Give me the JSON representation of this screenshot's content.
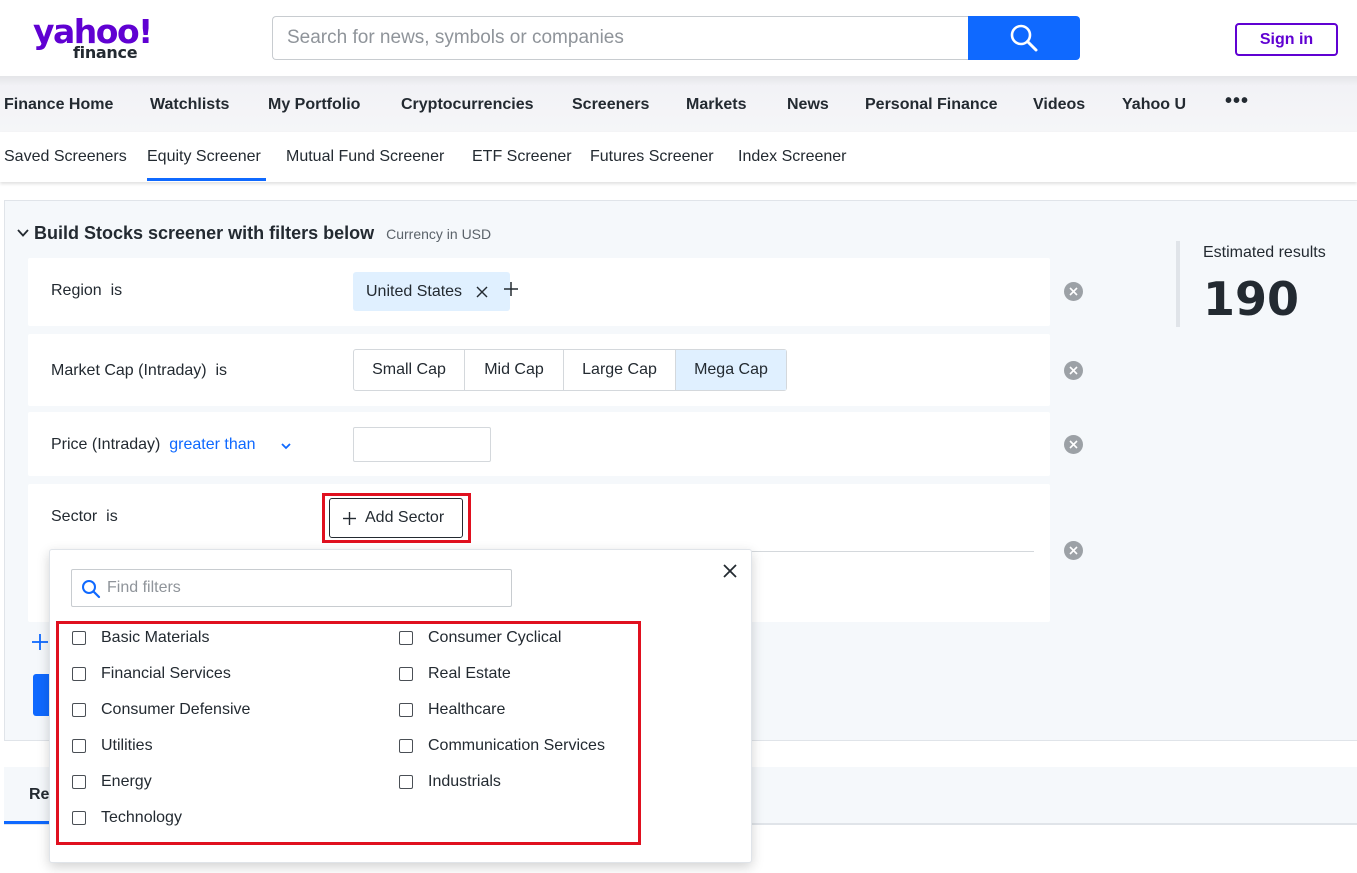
{
  "header": {
    "logo_top": "yahoo!",
    "logo_bottom": "finance",
    "search_placeholder": "Search for news, symbols or companies",
    "search_icon": "search-icon",
    "sign_in": "Sign in"
  },
  "main_nav": [
    "Finance Home",
    "Watchlists",
    "My Portfolio",
    "Cryptocurrencies",
    "Screeners",
    "Markets",
    "News",
    "Personal Finance",
    "Videos",
    "Yahoo U"
  ],
  "main_nav_more": "•••",
  "sub_nav": [
    "Saved Screeners",
    "Equity Screener",
    "Mutual Fund Screener",
    "ETF Screener",
    "Futures Screener",
    "Index Screener"
  ],
  "sub_nav_active": "Equity Screener",
  "screener": {
    "title": "Build Stocks screener with filters below",
    "currency": "Currency in USD",
    "region": {
      "label": "Region",
      "op": "is",
      "chip": "United States"
    },
    "market_cap": {
      "label": "Market Cap (Intraday)",
      "op": "is",
      "options": [
        "Small Cap",
        "Mid Cap",
        "Large Cap",
        "Mega Cap"
      ],
      "selected": "Mega Cap"
    },
    "price": {
      "label": "Price (Intraday)",
      "op": "greater than",
      "value": ""
    },
    "sector": {
      "label": "Sector",
      "op": "is",
      "add_button": "Add Sector"
    },
    "estimated_label": "Estimated results",
    "estimated_value": "190"
  },
  "tabs": {
    "first_tab_partial": "Re"
  },
  "sector_popup": {
    "search_placeholder": "Find filters",
    "left_column": [
      "Basic Materials",
      "Financial Services",
      "Consumer Defensive",
      "Utilities",
      "Energy",
      "Technology"
    ],
    "right_column": [
      "Consumer Cyclical",
      "Real Estate",
      "Healthcare",
      "Communication Services",
      "Industrials"
    ]
  },
  "colors": {
    "brand_purple": "#6001d2",
    "accent_blue": "#0f69ff",
    "highlight_red": "#e0101f",
    "chip_bg": "#e0f0ff"
  }
}
